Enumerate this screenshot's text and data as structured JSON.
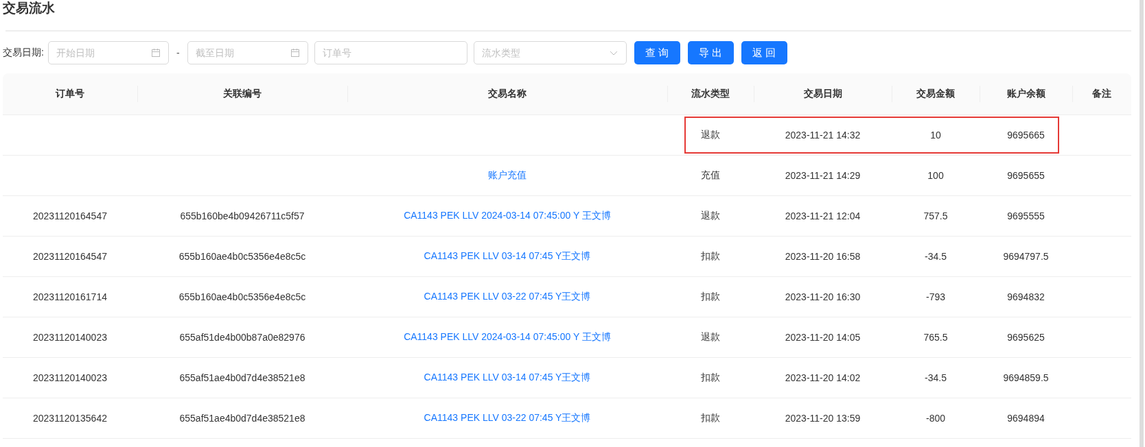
{
  "title": "交易流水",
  "filters": {
    "label": "交易日期:",
    "start_date": {
      "placeholder": "开始日期"
    },
    "separator": "-",
    "end_date": {
      "placeholder": "截至日期"
    },
    "order_no": {
      "placeholder": "订单号"
    },
    "flow_type": {
      "placeholder": "流水类型"
    }
  },
  "buttons": [
    "查 询",
    "导 出",
    "返 回"
  ],
  "table": {
    "columns": [
      "订单号",
      "关联编号",
      "交易名称",
      "流水类型",
      "交易日期",
      "交易金额",
      "账户余额",
      "备注"
    ],
    "rows": [
      {
        "order_no": "",
        "ref_no": "",
        "name": "",
        "type": "退款",
        "date": "2023-11-21 14:32",
        "amount": "10",
        "balance": "9695665",
        "highlighted": true
      },
      {
        "order_no": "",
        "ref_no": "",
        "name": "账户充值",
        "type": "充值",
        "date": "2023-11-21 14:29",
        "amount": "100",
        "balance": "9695655",
        "highlighted": false
      },
      {
        "order_no": "20231120164547",
        "ref_no": "655b160be4b09426711c5f57",
        "name": "CA1143 PEK LLV 2024-03-14 07:45:00 Y 王文博",
        "type": "退款",
        "date": "2023-11-21 12:04",
        "amount": "757.5",
        "balance": "9695555",
        "highlighted": false
      },
      {
        "order_no": "20231120164547",
        "ref_no": "655b160ae4b0c5356e4e8c5c",
        "name": "CA1143 PEK LLV 03-14 07:45 Y王文博",
        "type": "扣款",
        "date": "2023-11-20 16:58",
        "amount": "-34.5",
        "balance": "9694797.5",
        "highlighted": false
      },
      {
        "order_no": "20231120161714",
        "ref_no": "655b160ae4b0c5356e4e8c5c",
        "name": "CA1143 PEK LLV 03-22 07:45 Y王文博",
        "type": "扣款",
        "date": "2023-11-20 16:30",
        "amount": "-793",
        "balance": "9694832",
        "highlighted": false
      },
      {
        "order_no": "20231120140023",
        "ref_no": "655af51de4b00b87a0e82976",
        "name": "CA1143 PEK LLV 2024-03-14 07:45:00 Y 王文博",
        "type": "退款",
        "date": "2023-11-20 14:05",
        "amount": "765.5",
        "balance": "9695625",
        "highlighted": false
      },
      {
        "order_no": "20231120140023",
        "ref_no": "655af51ae4b0d7d4e38521e8",
        "name": "CA1143 PEK LLV 03-14 07:45 Y王文博",
        "type": "扣款",
        "date": "2023-11-20 14:02",
        "amount": "-34.5",
        "balance": "9694859.5",
        "highlighted": false
      },
      {
        "order_no": "20231120135642",
        "ref_no": "655af51ae4b0d7d4e38521e8",
        "name": "CA1143 PEK LLV 03-22 07:45 Y王文博",
        "type": "扣款",
        "date": "2023-11-20 13:59",
        "amount": "-800",
        "balance": "9694894",
        "highlighted": false
      }
    ]
  }
}
